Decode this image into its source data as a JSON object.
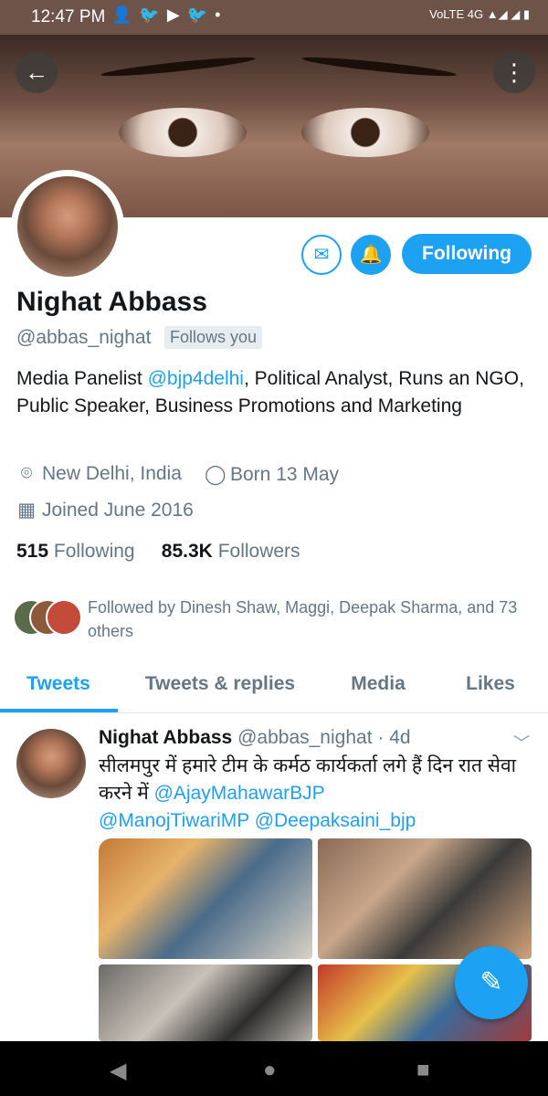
{
  "status_bar": {
    "time": "12:47 PM",
    "icons": [
      "add-person-icon",
      "twitter-icon",
      "youtube-icon",
      "twitter-icon",
      "dot-icon"
    ],
    "right_text": "VoLTE 4G"
  },
  "header": {
    "back_icon": "back-arrow-icon",
    "more_icon": "more-vertical-icon"
  },
  "profile": {
    "name": "Nighat Abbass",
    "handle": "@abbas_nighat",
    "follows_you": "Follows you",
    "bio_prefix": "Media Panelist ",
    "bio_mention": "@bjp4delhi",
    "bio_rest": ", Political Analyst, Runs an NGO, Public Speaker, Business Promotions and Marketing",
    "location": "New Delhi, India",
    "birthday": "Born 13 May",
    "joined": "Joined June 2016",
    "following_count": "515",
    "following_label": "Following",
    "followers_count": "85.3K",
    "followers_label": "Followers",
    "followed_by": "Followed by Dinesh Shaw, Maggi, Deepak Sharma, and 73 others"
  },
  "actions": {
    "following_button": "Following"
  },
  "tabs": [
    {
      "label": "Tweets"
    },
    {
      "label": "Tweets & replies"
    },
    {
      "label": "Media"
    },
    {
      "label": "Likes"
    }
  ],
  "tweet": {
    "name": "Nighat Abbass",
    "handle": "@abbas_nighat",
    "time": "· 4d",
    "text": "सीलमपुर में हमारे टीम के कर्मठ कार्यकर्ता लगे हैं  दिन रात सेवा करने में ",
    "mention_1": "@AjayMahawarBJP",
    "mention_2": "@ManojTiwariMP",
    "mention_3": "@Deepaksaini_bjp"
  },
  "colors": {
    "accent": "#1da1f2",
    "text": "#14171a",
    "muted": "#657786",
    "status_bar": "#6e5349"
  }
}
